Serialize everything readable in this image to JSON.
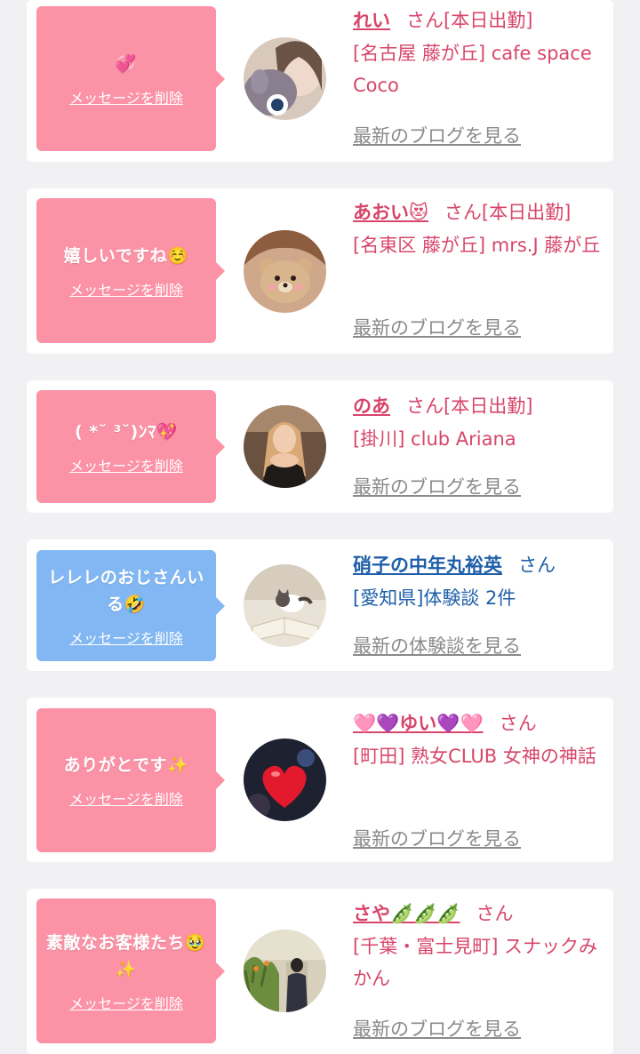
{
  "colors": {
    "pink_bubble": "#fb92a5",
    "blue_bubble": "#82b7f3",
    "pink_text": "#d8456a",
    "blue_text": "#1f5fa8",
    "gray_link": "#8a8a8a"
  },
  "cards": [
    {
      "bubble_color": "pink",
      "message": "💞",
      "delete_label": "メッセージを削除",
      "name": "れい",
      "suffix": "さん[本日出勤]",
      "shop": "[名古屋 藤が丘] cafe space Coco",
      "more": "最新のブログを見る",
      "avatar_icon": "girl-with-plush-icon"
    },
    {
      "bubble_color": "pink",
      "message": "嬉しいですね☺️",
      "delete_label": "メッセージを削除",
      "name": "あおい😻",
      "suffix": "さん[本日出勤]",
      "shop": "[名東区 藤が丘] mrs.J 藤が丘",
      "more": "最新のブログを見る",
      "avatar_icon": "bear-sticker-icon"
    },
    {
      "bubble_color": "pink",
      "message": "( *˘ ³˘)ﾝﾏ💖",
      "delete_label": "メッセージを削除",
      "name": "のあ",
      "suffix": "さん[本日出勤]",
      "shop": "[掛川] club Ariana",
      "more": "最新のブログを見る",
      "avatar_icon": "woman-portrait-icon"
    },
    {
      "bubble_color": "blue",
      "message": "レレレのおじさんいる🤣",
      "delete_label": "メッセージを削除",
      "name": "硝子の中年丸裕英",
      "suffix": "さん",
      "shop": "[愛知県]体験談 2件",
      "more": "最新の体験談を見る",
      "avatar_icon": "cat-on-book-icon"
    },
    {
      "bubble_color": "pink",
      "message": "ありがとです✨",
      "delete_label": "メッセージを削除",
      "name": "🩷💜ゆい💜🩷",
      "suffix": "さん",
      "shop": "[町田] 熟女CLUB 女神の神話",
      "more": "最新のブログを見る",
      "avatar_icon": "heart-sticker-icon"
    },
    {
      "bubble_color": "pink",
      "message": "素敵なお客様たち🥹✨",
      "delete_label": "メッセージを削除",
      "name": "さや🫛🫛🫛",
      "suffix": "さん",
      "shop": "[千葉・富士見町] スナックみかん",
      "more": "最新のブログを見る",
      "avatar_icon": "garden-woman-icon"
    }
  ]
}
